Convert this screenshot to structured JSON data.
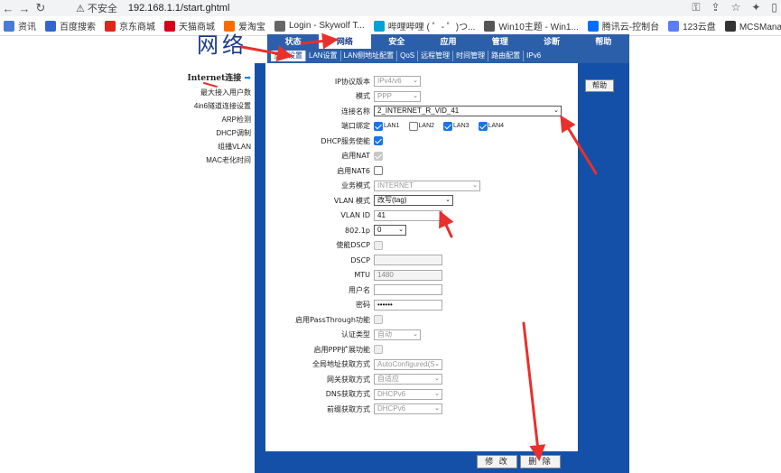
{
  "browser": {
    "warning": "不安全",
    "url": "192.168.1.1/start.ghtml",
    "bookmarks": [
      {
        "label": "资讯",
        "color": "#4a7bd6"
      },
      {
        "label": "百度搜索",
        "color": "#3366cc"
      },
      {
        "label": "京东商城",
        "color": "#e1251b"
      },
      {
        "label": "天猫商城",
        "color": "#d9001b"
      },
      {
        "label": "爱淘宝",
        "color": "#ff6a00"
      },
      {
        "label": "Login - Skywolf T...",
        "color": "#666666"
      },
      {
        "label": "哔哩哔哩 ( ゜- ゜)つ...",
        "color": "#00a1d6"
      },
      {
        "label": "Win10主题 - Win1...",
        "color": "#555555"
      },
      {
        "label": "腾讯云-控制台",
        "color": "#006eff"
      },
      {
        "label": "123云盘",
        "color": "#597dfc"
      },
      {
        "label": "MCSManager 管...",
        "color": "#333333"
      }
    ]
  },
  "router": {
    "logo": "网络",
    "tabs": [
      "状态",
      "网络",
      "安全",
      "应用",
      "管理",
      "诊断",
      "帮助"
    ],
    "active_tab": 1,
    "subtabs": [
      "宽带设置",
      "LAN设置",
      "LAN侧地址配置",
      "QoS",
      "远程管理",
      "时间管理",
      "路由配置",
      "IPv6"
    ],
    "sidebar": [
      "Internet连接",
      "最大接入用户数",
      "4in6隧道连接设置",
      "ARP检测",
      "DHCP调制",
      "组播VLAN",
      "MAC老化时间"
    ],
    "help_label": "帮助",
    "modify_label": "修 改",
    "delete_label": "删 除"
  },
  "form": {
    "ip_version": {
      "label": "IP协议版本",
      "value": "IPv4/v6"
    },
    "mode": {
      "label": "模式",
      "value": "PPP"
    },
    "conn_name": {
      "label": "连接名称",
      "value": "2_INTERNET_R_VID_41"
    },
    "port_bind": {
      "label": "端口绑定",
      "ports": [
        {
          "name": "LAN1",
          "checked": true
        },
        {
          "name": "LAN2",
          "checked": false
        },
        {
          "name": "LAN3",
          "checked": true
        },
        {
          "name": "LAN4",
          "checked": true
        }
      ]
    },
    "dhcp_enable": {
      "label": "DHCP服务使能",
      "checked": true
    },
    "nat_enable": {
      "label": "启用NAT",
      "checked": true,
      "disabled": true
    },
    "nat6_enable": {
      "label": "启用NAT6",
      "checked": false
    },
    "service_mode": {
      "label": "业务模式",
      "value": "INTERNET"
    },
    "vlan_mode": {
      "label": "VLAN 模式",
      "value": "改写(tag)"
    },
    "vlan_id": {
      "label": "VLAN ID",
      "value": "41"
    },
    "dot1p": {
      "label": "802.1p",
      "value": "0"
    },
    "dscp_enable": {
      "label": "使能DSCP"
    },
    "dscp": {
      "label": "DSCP",
      "value": ""
    },
    "mtu": {
      "label": "MTU",
      "value": "1480"
    },
    "username": {
      "label": "用户名",
      "value": ""
    },
    "password": {
      "label": "密码",
      "value": "••••••"
    },
    "passthrough": {
      "label": "启用PassThrough功能"
    },
    "auth_type": {
      "label": "认证类型",
      "value": "自动"
    },
    "ppp_ext": {
      "label": "启用PPP扩展功能"
    },
    "global_addr": {
      "label": "全局地址获取方式",
      "value": "AutoConfigured(S"
    },
    "gateway": {
      "label": "网关获取方式",
      "value": "自适应"
    },
    "dns": {
      "label": "DNS获取方式",
      "value": "DHCPv6"
    },
    "prefix": {
      "label": "前缀获取方式",
      "value": "DHCPv6"
    }
  },
  "annotation_color": "#e8302c"
}
